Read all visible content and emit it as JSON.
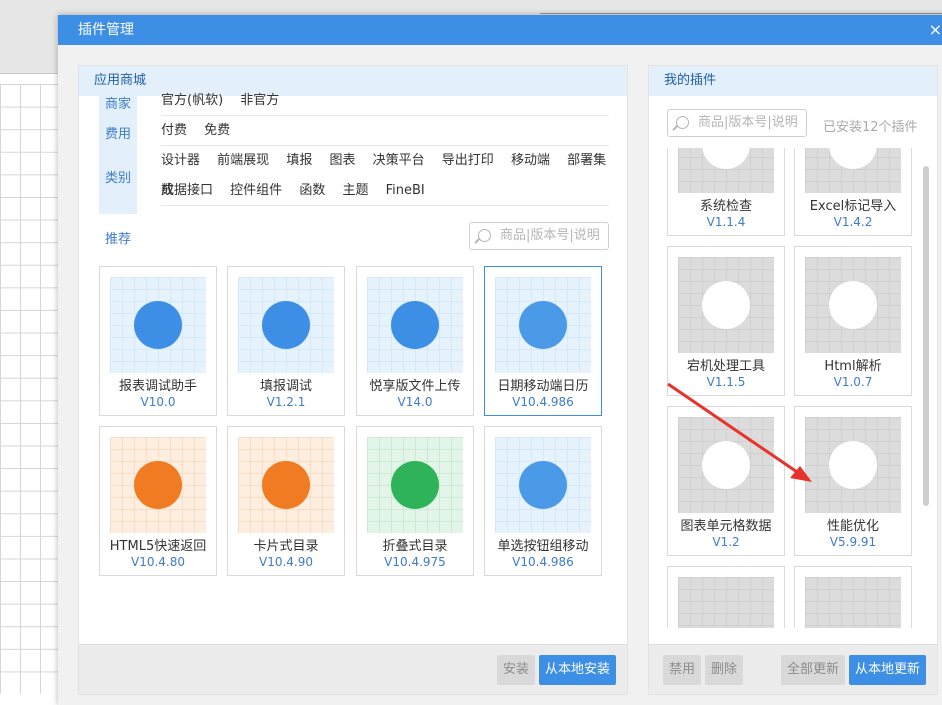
{
  "dialog": {
    "title": "插件管理",
    "close": "×"
  },
  "store": {
    "header": "应用商城",
    "filters": {
      "labels": {
        "merchant": "商家",
        "fee": "费用",
        "category": "类别"
      },
      "merchant": [
        "官方(帆软)",
        "非官方"
      ],
      "fee": [
        "付费",
        "免费"
      ],
      "category_row1": [
        "设计器",
        "前端展现",
        "填报",
        "图表",
        "决策平台",
        "导出打印",
        "移动端",
        "部署集成"
      ],
      "category_row2": [
        "数据接口",
        "控件组件",
        "函数",
        "主题",
        "FineBI"
      ]
    },
    "recommend_label": "推荐",
    "search_placeholder": "商品|版本号|说明",
    "cards": [
      {
        "name": "报表调试助手",
        "version": "V10.0",
        "theme": "blue",
        "icon": "sql-report-icon"
      },
      {
        "name": "填报调试",
        "version": "V1.2.1",
        "theme": "blue",
        "icon": "form-debug-icon"
      },
      {
        "name": "悦享版文件上传",
        "version": "V14.0",
        "theme": "blue",
        "icon": "file-upload-icon"
      },
      {
        "name": "日期移动端日历",
        "version": "V10.4.986",
        "theme": "blue",
        "icon": "mobile-calendar-icon"
      },
      {
        "name": "HTML5快速返回",
        "version": "V10.4.80",
        "theme": "orange",
        "icon": "html5-return-icon"
      },
      {
        "name": "卡片式目录",
        "version": "V10.4.90",
        "theme": "orange",
        "icon": "card-directory-icon"
      },
      {
        "name": "折叠式目录",
        "version": "V10.4.975",
        "theme": "green",
        "icon": "fold-directory-icon"
      },
      {
        "name": "单选按钮组移动",
        "version": "V10.4.986",
        "theme": "blue",
        "icon": "radio-mobile-icon"
      }
    ],
    "install": "安装",
    "install_local": "从本地安装"
  },
  "mine": {
    "header": "我的插件",
    "search_placeholder": "商品|版本号|说明",
    "installed_count": "已安装12个插件",
    "plugins": [
      {
        "name": "系统检查",
        "version": "V1.1.4"
      },
      {
        "name": "Excel标记导入",
        "version": "V1.4.2"
      },
      {
        "name": "宕机处理工具",
        "version": "V1.1.5"
      },
      {
        "name": "Html解析",
        "version": "V1.0.7"
      },
      {
        "name": "图表单元格数据",
        "version": "V1.2"
      },
      {
        "name": "性能优化",
        "version": "V5.9.91"
      }
    ],
    "disable": "禁用",
    "delete": "删除",
    "update_all": "全部更新",
    "update_local": "从本地更新"
  },
  "colors": {
    "accent": "#3d8ee5",
    "annotation_arrow": "#e8322b"
  }
}
